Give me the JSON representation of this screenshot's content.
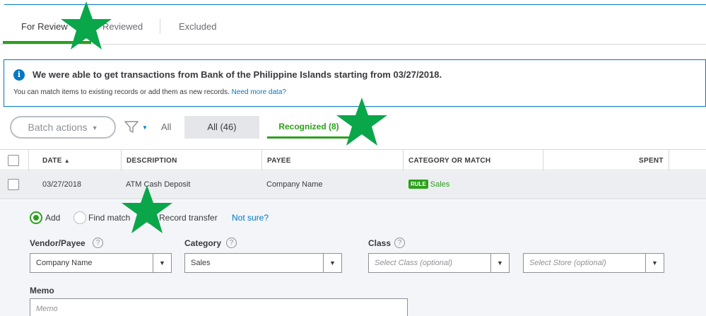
{
  "tabs": [
    {
      "label": "For Review"
    },
    {
      "label": "Reviewed"
    },
    {
      "label": "Excluded"
    }
  ],
  "banner": {
    "title": "We were able to get transactions from Bank of the Philippine Islands starting from 03/27/2018.",
    "subtitle": "You can match items to existing records or add them as new records.",
    "link": "Need more data?"
  },
  "toolbar": {
    "batch_label": "Batch actions",
    "all_label": "All",
    "seg_all": "All (46)",
    "seg_recognized": "Recognized (8)"
  },
  "table": {
    "headers": {
      "date": "DATE",
      "description": "DESCRIPTION",
      "payee": "PAYEE",
      "category": "CATEGORY OR MATCH",
      "spent": "SPENT"
    },
    "row": {
      "date": "03/27/2018",
      "description": "ATM Cash Deposit",
      "payee": "Company Name",
      "badge": "RULE",
      "match": "Sales"
    }
  },
  "panel": {
    "radios": {
      "add": "Add",
      "find": "Find match",
      "transfer": "Record transfer",
      "not_sure": "Not sure?"
    },
    "vendor_label": "Vendor/Payee",
    "vendor_value": "Company Name",
    "category_label": "Category",
    "category_value": "Sales",
    "class_label": "Class",
    "class_placeholder": "Select Class (optional)",
    "store_placeholder": "Select Store (optional)",
    "memo_label": "Memo",
    "memo_placeholder": "Memo"
  },
  "colors": {
    "accent_green": "#2ca01c",
    "link_blue": "#0077c5",
    "star_green": "#0aa64a"
  },
  "icons": [
    "info-icon",
    "filter-icon",
    "sort-up-icon",
    "help-icon",
    "chevron-down-icon",
    "star-icon"
  ]
}
